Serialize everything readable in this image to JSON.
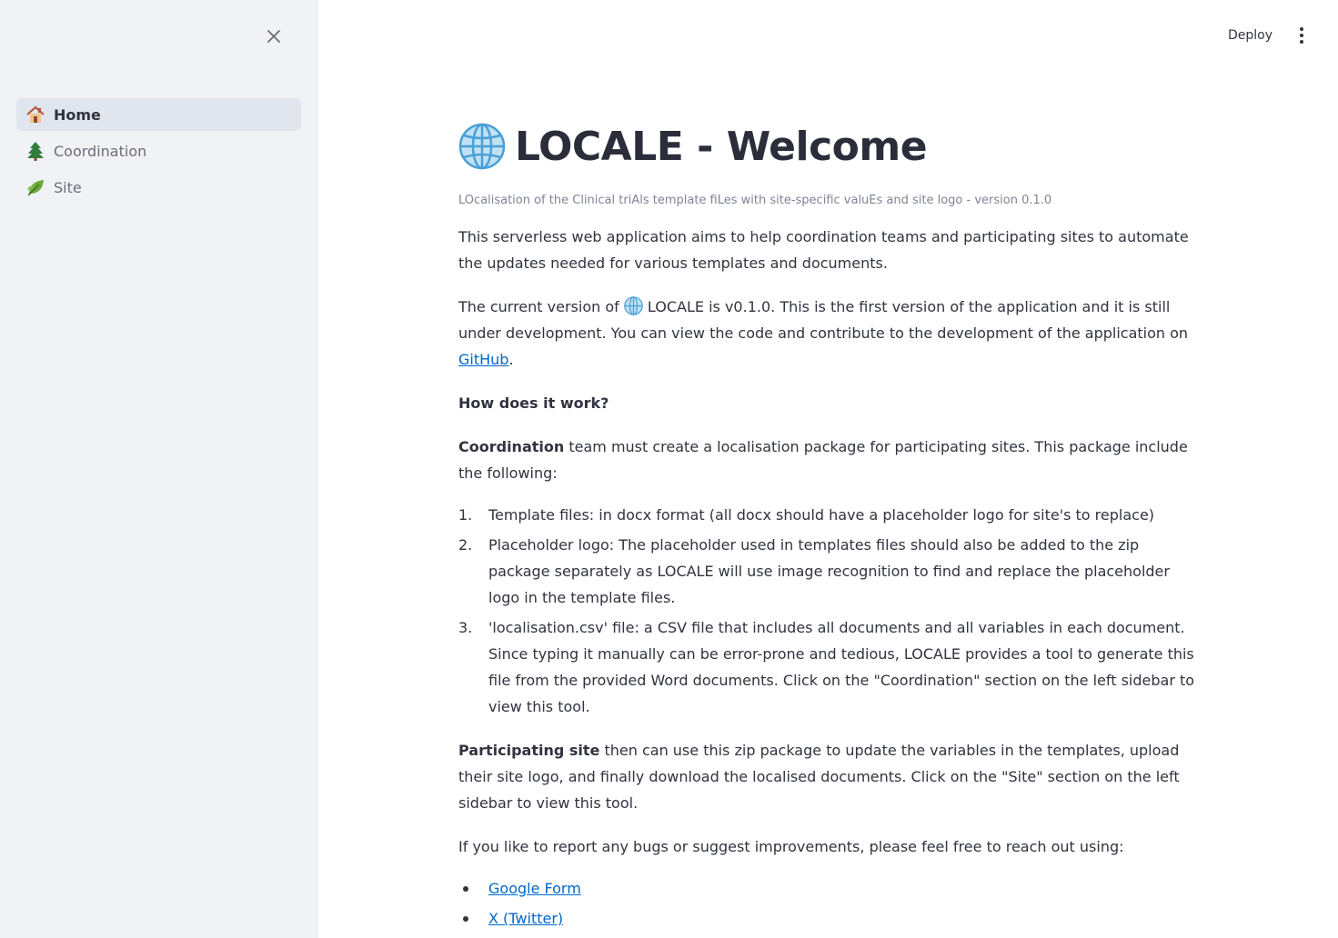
{
  "sidebar": {
    "close_icon": "close-icon",
    "items": [
      {
        "label": "Home",
        "icon": "house-icon",
        "active": true
      },
      {
        "label": "Coordination",
        "icon": "tree-icon",
        "active": false
      },
      {
        "label": "Site",
        "icon": "leaf-icon",
        "active": false
      }
    ]
  },
  "header": {
    "deploy_label": "Deploy",
    "menu_icon": "more-vertical-icon"
  },
  "main": {
    "title": "LOCALE - Welcome",
    "title_icon": "globe-icon",
    "subtitle": "LOcalisation of the Clinical triAls template fiLes with site-specific valuEs and site logo - version 0.1.0",
    "intro": "This serverless web application aims to help coordination teams and participating sites to automate the updates needed for various templates and documents.",
    "version_p_before": "The current version of ",
    "version_p_after": " LOCALE is v0.1.0. This is the first version of the application and it is still under development. You can view the code and contribute to the development of the application on ",
    "github_link": "GitHub",
    "version_p_end": ".",
    "how_heading": "How does it work?",
    "coord_bold": "Coordination",
    "coord_text": " team must create a localisation package for participating sites. This package include the following:",
    "steps": [
      {
        "num": "1.",
        "text": "Template files: in docx format (all docx should have a placeholder logo for site's to replace)"
      },
      {
        "num": "2.",
        "text": "Placeholder logo: The placeholder used in templates files should also be added to the zip package separately as LOCALE will use image recognition to find and replace the placeholder logo in the template files."
      },
      {
        "num": "3.",
        "text": "'localisation.csv' file: a CSV file that includes all documents and all variables in each document. Since typing it manually can be error-prone and tedious, LOCALE provides a tool to generate this file from the provided Word documents. Click on the \"Coordination\" section on the left sidebar to view this tool."
      }
    ],
    "site_bold": "Participating site",
    "site_text": " then can use this zip package to update the variables in the templates, upload their site logo, and finally download the localised documents. Click on the \"Site\" section on the left sidebar to view this tool.",
    "report_text": "If you like to report any bugs or suggest improvements, please feel free to reach out using:",
    "links": [
      "Google Form",
      "X (Twitter)"
    ],
    "link_color": "#0068c9"
  }
}
